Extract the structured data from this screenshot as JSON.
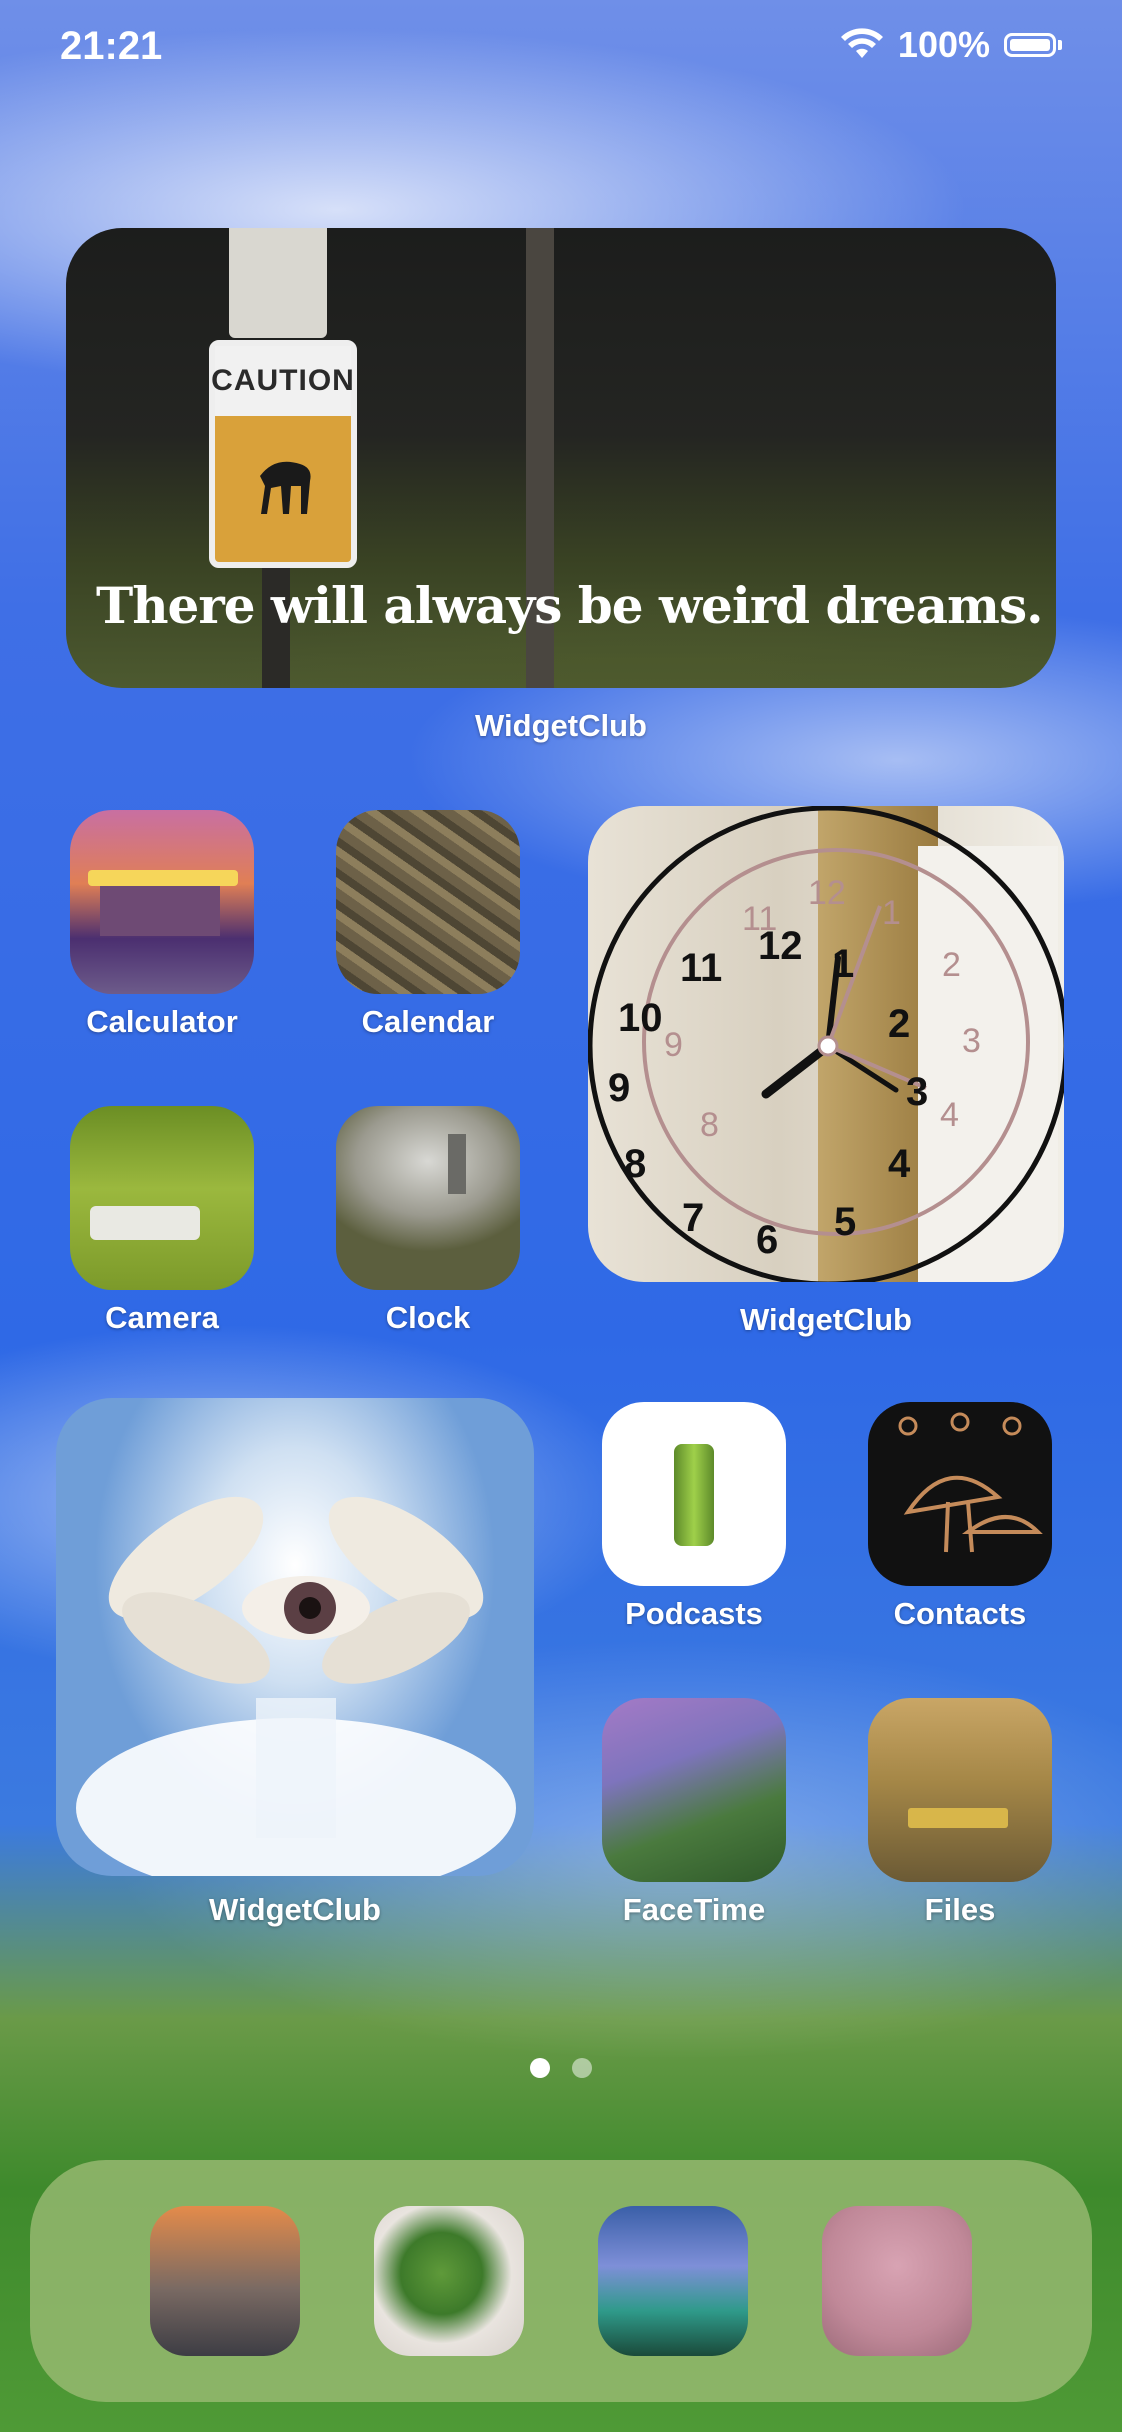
{
  "status_bar": {
    "time": "21:21",
    "battery_percent": "100%",
    "wifi_icon": "wifi-icon",
    "battery_icon": "battery-icon"
  },
  "top_widget": {
    "quote": "There will always be weird dreams.",
    "label": "WidgetClub",
    "sign_text": "CAUTION"
  },
  "apps_row1": [
    {
      "label": "Calculator"
    },
    {
      "label": "Calendar"
    }
  ],
  "apps_row2": [
    {
      "label": "Camera"
    },
    {
      "label": "Clock"
    }
  ],
  "clock_widget": {
    "label": "WidgetClub",
    "numbers": [
      "12",
      "1",
      "2",
      "3",
      "4",
      "5",
      "6",
      "7",
      "8",
      "9",
      "10",
      "11"
    ]
  },
  "eye_widget": {
    "label": "WidgetClub"
  },
  "apps_row3": [
    {
      "label": "Podcasts"
    },
    {
      "label": "Contacts"
    }
  ],
  "apps_row4": [
    {
      "label": "FaceTime"
    },
    {
      "label": "Files"
    }
  ],
  "page_indicator": {
    "pages": 2,
    "current": 1
  },
  "dock": {
    "apps": [
      "dock-app-1",
      "dock-app-2",
      "dock-app-3",
      "dock-app-4"
    ]
  }
}
